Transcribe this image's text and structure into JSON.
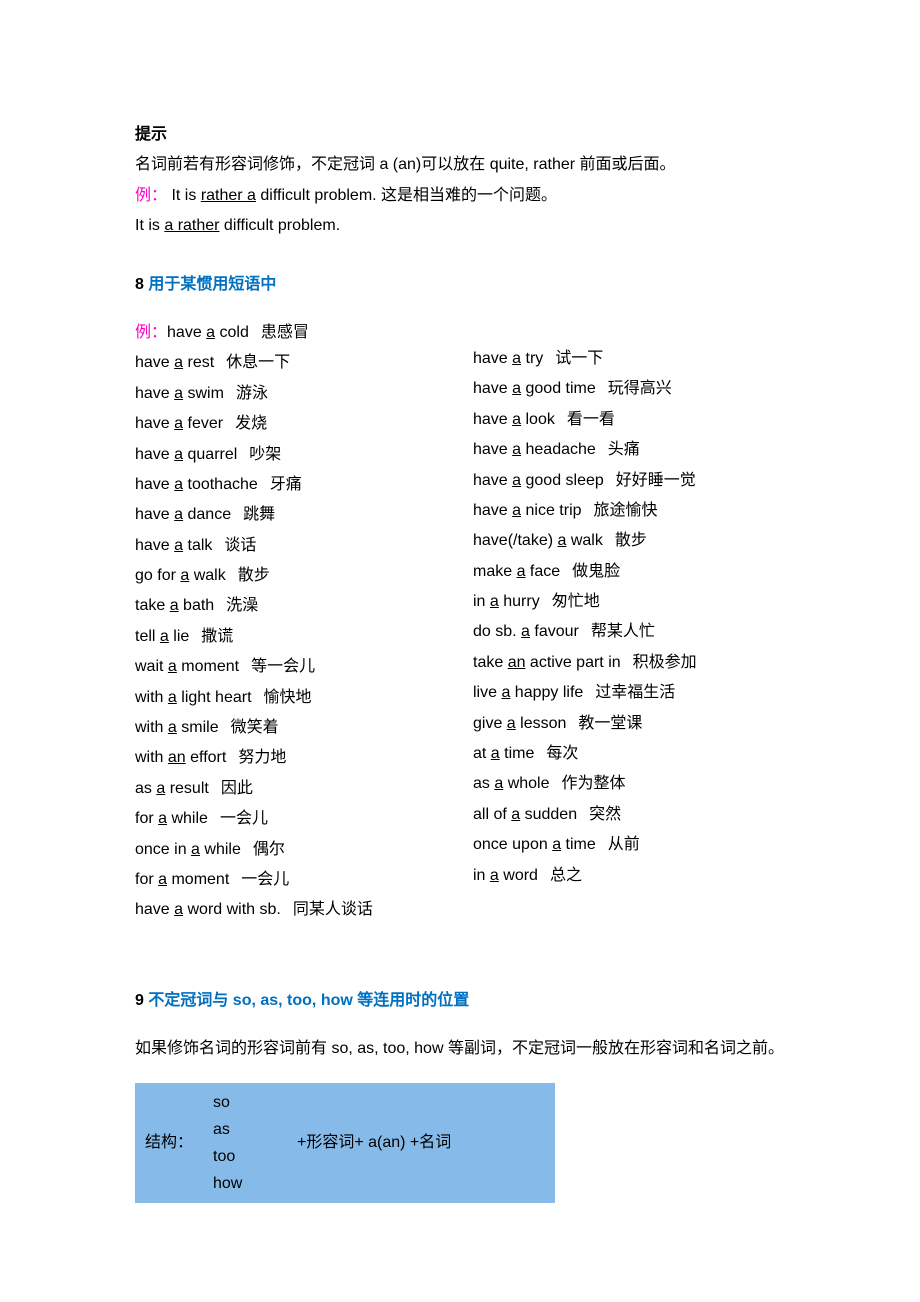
{
  "tip": {
    "heading": "提示",
    "line1_a": "名词前若有形容词修饰，不定冠词 a (an)可以放在 quite, rather 前面或后面。",
    "ex_label": "例：",
    "ex1_pre": "It is ",
    "ex1_u": "rather a",
    "ex1_post": " difficult problem.  这是相当难的一个问题。",
    "ex2_pre": "It is ",
    "ex2_u": "a rather",
    "ex2_post": " difficult problem."
  },
  "section8": {
    "num": "8",
    "title": "用于某惯用短语中",
    "ex_label": "例：",
    "left": [
      {
        "pre": "have ",
        "u": "a",
        "post": " cold",
        "zh": "患感冒"
      },
      {
        "pre": "have ",
        "u": "a",
        "post": " rest",
        "zh": "休息一下"
      },
      {
        "pre": "have ",
        "u": "a",
        "post": " swim",
        "zh": "游泳"
      },
      {
        "pre": "have ",
        "u": "a",
        "post": " fever",
        "zh": "发烧"
      },
      {
        "pre": "have ",
        "u": "a",
        "post": " quarrel",
        "zh": "吵架"
      },
      {
        "pre": "have ",
        "u": "a",
        "post": " toothache",
        "zh": "牙痛"
      },
      {
        "pre": "have ",
        "u": "a",
        "post": " dance",
        "zh": "跳舞"
      },
      {
        "pre": "have ",
        "u": "a",
        "post": " talk",
        "zh": "谈话"
      },
      {
        "pre": "go for ",
        "u": "a",
        "post": " walk",
        "zh": "散步"
      },
      {
        "pre": "take ",
        "u": "a",
        "post": " bath",
        "zh": "洗澡"
      },
      {
        "pre": "tell ",
        "u": "a",
        "post": " lie",
        "zh": "撒谎"
      },
      {
        "pre": "wait ",
        "u": "a",
        "post": " moment",
        "zh": "等一会儿"
      },
      {
        "pre": "with ",
        "u": "a",
        "post": " light heart",
        "zh": "愉快地"
      },
      {
        "pre": "with ",
        "u": "a",
        "post": " smile",
        "zh": "微笑着"
      },
      {
        "pre": "with ",
        "u": "an",
        "post": " effort",
        "zh": "努力地"
      },
      {
        "pre": "as ",
        "u": "a",
        "post": " result",
        "zh": "因此"
      },
      {
        "pre": "for ",
        "u": "a",
        "post": " while",
        "zh": "一会儿"
      },
      {
        "pre": "once in ",
        "u": "a",
        "post": " while",
        "zh": "偶尔"
      },
      {
        "pre": "for ",
        "u": "a",
        "post": " moment",
        "zh": "一会儿"
      },
      {
        "pre": "have ",
        "u": "a",
        "post": " word with sb.",
        "zh": "同某人谈话"
      }
    ],
    "right": [
      {
        "pre": "have ",
        "u": "a",
        "post": " try",
        "zh": "试一下"
      },
      {
        "pre": "have ",
        "u": "a",
        "post": " good time",
        "zh": "玩得高兴"
      },
      {
        "pre": "have ",
        "u": "a",
        "post": " look",
        "zh": "看一看"
      },
      {
        "pre": "have ",
        "u": "a",
        "post": " headache",
        "zh": "头痛"
      },
      {
        "pre": "have ",
        "u": "a",
        "post": " good sleep",
        "zh": "好好睡一觉"
      },
      {
        "pre": "have ",
        "u": "a",
        "post": " nice trip",
        "zh": "旅途愉快"
      },
      {
        "pre": "have(/take) ",
        "u": "a",
        "post": " walk",
        "zh": "散步"
      },
      {
        "pre": "make ",
        "u": "a",
        "post": " face",
        "zh": "做鬼脸"
      },
      {
        "pre": "in ",
        "u": "a",
        "post": " hurry",
        "zh": "匆忙地"
      },
      {
        "pre": "do sb. ",
        "u": "a",
        "post": " favour",
        "zh": "帮某人忙"
      },
      {
        "pre": "take ",
        "u": "an",
        "post": " active part in",
        "zh": "积极参加"
      },
      {
        "pre": "live ",
        "u": "a",
        "post": " happy life",
        "zh": "过幸福生活"
      },
      {
        "pre": "give ",
        "u": "a",
        "post": " lesson",
        "zh": "教一堂课"
      },
      {
        "pre": "at ",
        "u": "a",
        "post": " time",
        "zh": "每次"
      },
      {
        "pre": "as ",
        "u": "a",
        "post": " whole",
        "zh": "作为整体"
      },
      {
        "pre": "all of ",
        "u": "a",
        "post": " sudden",
        "zh": "突然"
      },
      {
        "pre": "once upon ",
        "u": "a",
        "post": " time",
        "zh": "从前"
      },
      {
        "pre": "in ",
        "u": "a",
        "post": " word",
        "zh": "总之"
      }
    ]
  },
  "section9": {
    "num": "9",
    "title": "不定冠词与 so, as, too, how 等连用时的位置",
    "desc": "如果修饰名词的形容词前有 so, as, too, how 等副词，不定冠词一般放在形容词和名词之前。",
    "table": {
      "c1": "结构：",
      "c2_lines": [
        "so",
        "as",
        "too",
        "how"
      ],
      "c3": "+形容词+ a(an) +名词"
    }
  }
}
